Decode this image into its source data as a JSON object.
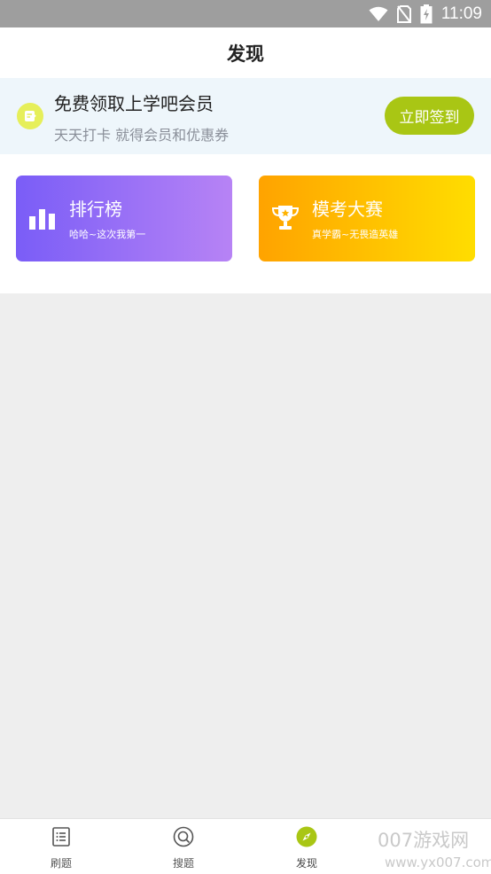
{
  "status_bar": {
    "time": "11:09"
  },
  "header": {
    "title": "发现"
  },
  "promo": {
    "title": "免费领取上学吧会员",
    "subtitle": "天天打卡 就得会员和优惠券",
    "button": "立即签到"
  },
  "cards": [
    {
      "title": "排行榜",
      "subtitle": "哈哈~这次我第一",
      "icon": "bar-chart-icon"
    },
    {
      "title": "模考大赛",
      "subtitle": "真学霸~无畏造英雄",
      "icon": "trophy-icon"
    }
  ],
  "tabs": [
    {
      "label": "刷题",
      "icon": "list-icon",
      "active": false
    },
    {
      "label": "搜题",
      "icon": "search-icon",
      "active": false
    },
    {
      "label": "发现",
      "icon": "compass-icon",
      "active": true
    }
  ],
  "watermark": {
    "line1": "007游戏网",
    "line2": "www.yx007.com"
  },
  "colors": {
    "accent": "#a9c614",
    "rank_start": "#7a5df7",
    "rank_end": "#b783f5",
    "exam_start": "#ffa300",
    "exam_end": "#ffdd00"
  }
}
